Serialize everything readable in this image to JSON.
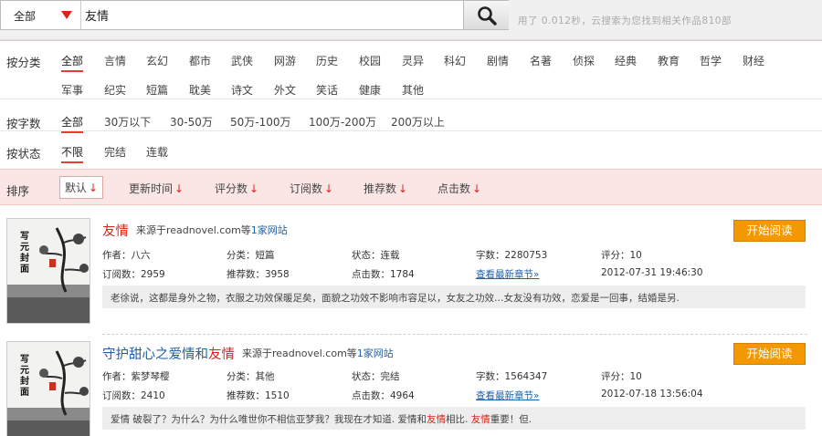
{
  "search": {
    "category": "全部",
    "query": "友情",
    "stat_text": "用了 0.012秒，云搜索为您找到相关作品810部"
  },
  "filters": {
    "category": {
      "label": "按分类",
      "row1": [
        "全部",
        "言情",
        "玄幻",
        "都市",
        "武侠",
        "网游",
        "历史",
        "校园",
        "灵异",
        "科幻",
        "剧情",
        "名著",
        "侦探",
        "经典",
        "教育",
        "哲学",
        "财经"
      ],
      "row2": [
        "军事",
        "纪实",
        "短篇",
        "耽美",
        "诗文",
        "外文",
        "笑话",
        "健康",
        "其他"
      ]
    },
    "words": {
      "label": "按字数",
      "options": [
        "全部",
        "30万以下",
        "30-50万",
        "50万-100万",
        "100万-200万",
        "200万以上"
      ]
    },
    "status": {
      "label": "按状态",
      "options": [
        "不限",
        "完结",
        "连载"
      ]
    }
  },
  "sort": {
    "label": "排序",
    "options": [
      "默认",
      "更新时间",
      "评分数",
      "订阅数",
      "推荐数",
      "点击数"
    ],
    "arrow": "↓"
  },
  "results": [
    {
      "title_hl": "友情",
      "title_pre": "",
      "title_post": "",
      "source_prefix": "来源于readnovel.com等",
      "source_link": "1家网站",
      "read_label": "开始阅读",
      "author": "作者：八六",
      "category": "分类：短篇",
      "status": "状态：连载",
      "words": "字数：2280753",
      "score": "评分：10",
      "subs": "订阅数：2959",
      "recs": "推荐数：3958",
      "clicks": "点击数：1784",
      "latest": "查看最新章节»",
      "date": "2012-07-31 19:46:30",
      "desc": "老徐说，这都是身外之物，衣服之功效保暖足矣，面貌之功效不影响市容足以，女友之功效…女友没有功效，恋爱是一回事，结婚是另."
    },
    {
      "title_pre": "守护甜心之爱情和",
      "title_hl": "友情",
      "title_post": "",
      "source_prefix": "来源于readnovel.com等",
      "source_link": "1家网站",
      "read_label": "开始阅读",
      "author": "作者：紫梦琴樱",
      "category": "分类：其他",
      "status": "状态：完结",
      "words": "字数：1564347",
      "score": "评分：10",
      "subs": "订阅数：2410",
      "recs": "推荐数：1510",
      "clicks": "点击数：4964",
      "latest": "查看最新章节»",
      "date": "2012-07-18 13:56:04",
      "desc_a": "爱情 破裂了？为什么？为什么唯世你不相信亚梦我？我现在才知道. 爱情和",
      "desc_hl1": "友情",
      "desc_b": "相比. ",
      "desc_hl2": "友情",
      "desc_c": "重要！但."
    }
  ],
  "colors": {
    "accent": "#d8261b",
    "link": "#1f5ea8",
    "button": "#f39800",
    "sortbar": "#fbe6e6"
  }
}
